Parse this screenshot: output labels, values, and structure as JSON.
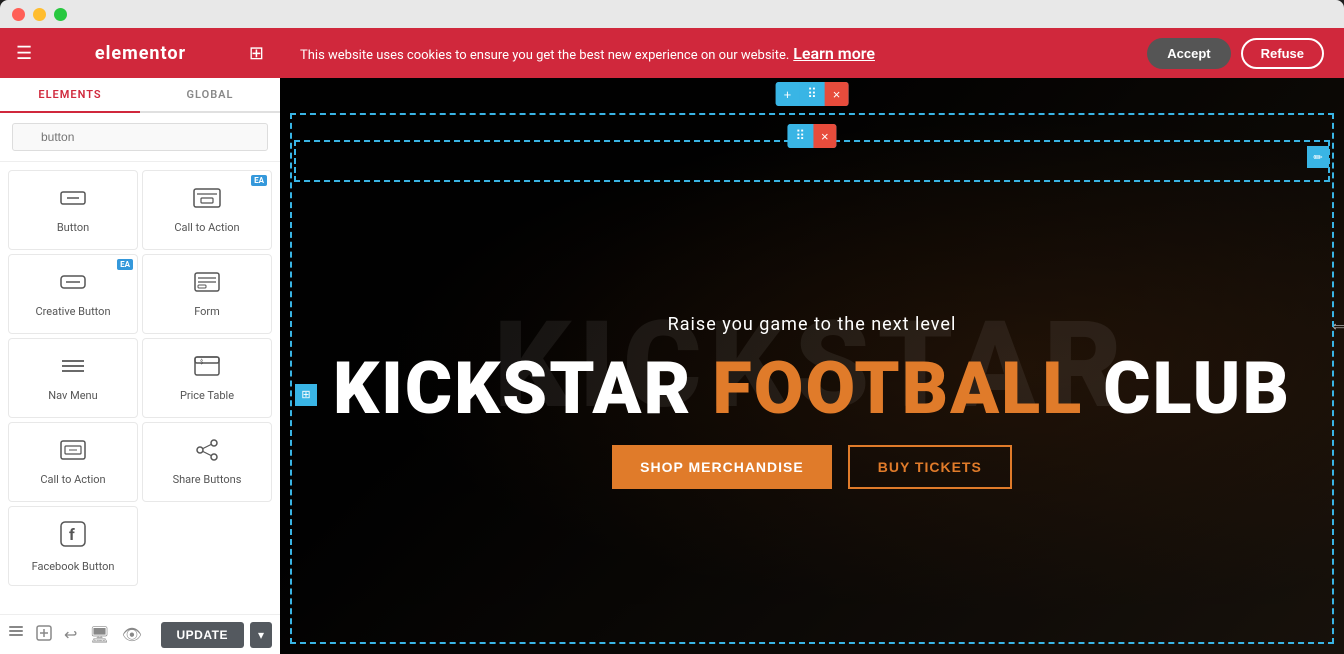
{
  "window": {
    "traffic_lights": [
      "red",
      "yellow",
      "green"
    ]
  },
  "sidebar": {
    "header": {
      "title": "elementor",
      "hamburger": "☰",
      "grid": "⊞"
    },
    "tabs": [
      {
        "id": "elements",
        "label": "ELEMENTS",
        "active": true
      },
      {
        "id": "global",
        "label": "GLOBAL",
        "active": false
      }
    ],
    "search": {
      "placeholder": "button",
      "icon": "🔍"
    },
    "elements": [
      {
        "id": "button",
        "label": "Button",
        "icon": "button",
        "ea": false
      },
      {
        "id": "call-to-action",
        "label": "Call to Action",
        "icon": "cta",
        "ea": true
      },
      {
        "id": "creative-button",
        "label": "Creative Button",
        "icon": "creative-btn",
        "ea": true
      },
      {
        "id": "form",
        "label": "Form",
        "icon": "form",
        "ea": false
      },
      {
        "id": "nav-menu",
        "label": "Nav Menu",
        "icon": "nav",
        "ea": false
      },
      {
        "id": "price-table",
        "label": "Price Table",
        "icon": "price",
        "ea": false
      },
      {
        "id": "call-to-action-2",
        "label": "Call to Action",
        "icon": "cta2",
        "ea": false
      },
      {
        "id": "share-buttons",
        "label": "Share Buttons",
        "icon": "share",
        "ea": false
      },
      {
        "id": "facebook-button",
        "label": "Facebook Button",
        "icon": "fb",
        "ea": false
      }
    ],
    "bottom": {
      "update_label": "UPDATE",
      "chevron": "▾",
      "icons": [
        "layers",
        "add-section",
        "undo",
        "desktop",
        "eye"
      ]
    }
  },
  "cookie_bar": {
    "text": "This website uses cookies to ensure you get the best new experience on our website.",
    "link_text": "Learn more",
    "accept_label": "Accept",
    "refuse_label": "Refuse"
  },
  "canvas": {
    "section_toolbar": {
      "add": "+",
      "move": "⠿",
      "close": "×"
    },
    "widget_toolbar": {
      "move": "⠿",
      "close": "×"
    },
    "hero": {
      "bg_text": "KICKSTAR",
      "tagline": "Raise you game to the next level",
      "title_white1": "KICKSTAR",
      "title_orange": "FOOTBALL",
      "title_white2": "CLUB",
      "shop_btn": "SHOP MERCHANDISE",
      "tickets_btn": "BUY TICKETS"
    }
  }
}
